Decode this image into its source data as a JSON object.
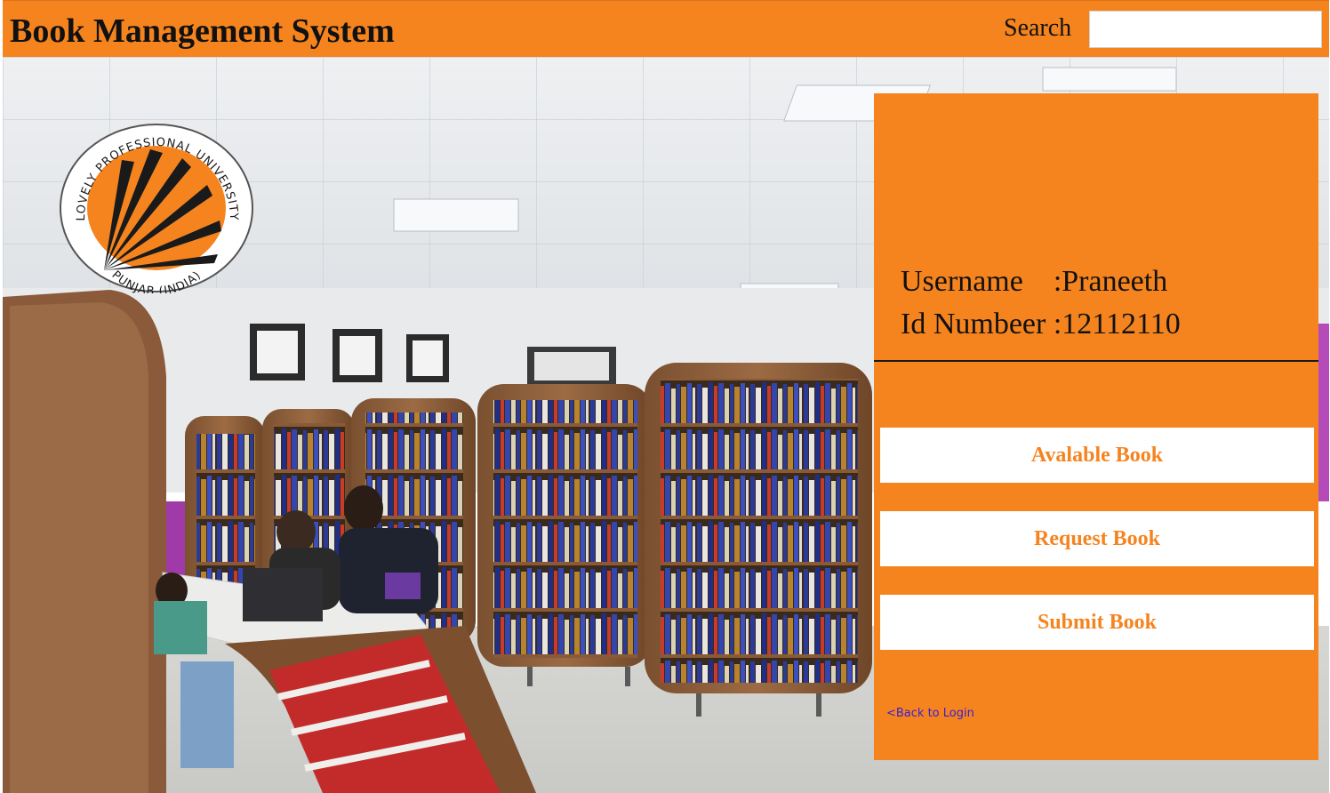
{
  "header": {
    "title": "Book Management System",
    "search_label": "Search",
    "search_value": ""
  },
  "logo": {
    "text_top": "LOVELY PROFESSIONAL UNIVERSITY",
    "text_bottom": "PUNJAB (INDIA)"
  },
  "user": {
    "username_line": "Username    :Praneeth",
    "id_line": "Id Numbeer :12112110"
  },
  "actions": {
    "available_label": "Avalable Book",
    "request_label": "Request Book",
    "submit_label": "Submit Book",
    "back_label": "<Back to Login"
  },
  "colors": {
    "accent": "#f5841f",
    "button_bg": "#ffffff",
    "link": "#3b1ecf"
  }
}
